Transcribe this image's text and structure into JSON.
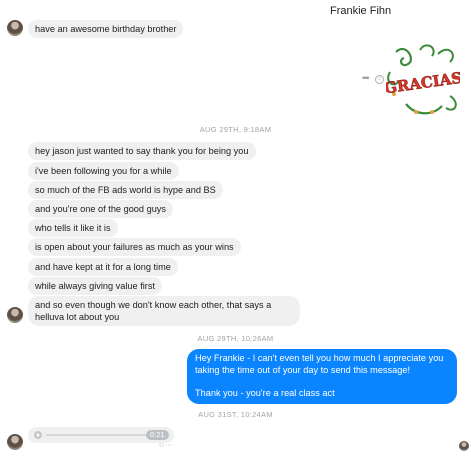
{
  "header": {
    "title": "Frankie Fihn"
  },
  "sticker": {
    "text": "GRACIAS"
  },
  "timestamps": [
    "AUG 29TH, 9:18AM",
    "AUG 29TH, 10:26AM",
    "AUG 31ST, 10:24AM"
  ],
  "incoming_top": "have an awesome birthday brother",
  "incoming_messages": [
    "hey jason just wanted to say thank you for being you",
    "i've been following you for a while",
    "so much of the FB ads world is hype and BS",
    "and you're one of the good guys",
    "who tells it like it is",
    "is open about your failures as much as your wins",
    "and have kept at it for a long time",
    "while always giving value first",
    "and so even though we don't know each other, that says a helluva lot about you"
  ],
  "outgoing_message": {
    "lines": [
      "Hey Frankie - I can't even tell you how much I appreciate you taking the time out of your day to send this message!",
      "",
      "Thank you - you're a real class act"
    ]
  },
  "audio": {
    "duration": "0:21"
  },
  "colors": {
    "outgoing": "#0a84ff",
    "incoming": "#f1f0f0",
    "sticker_red": "#d9352a",
    "sticker_green": "#3c8b3a"
  }
}
